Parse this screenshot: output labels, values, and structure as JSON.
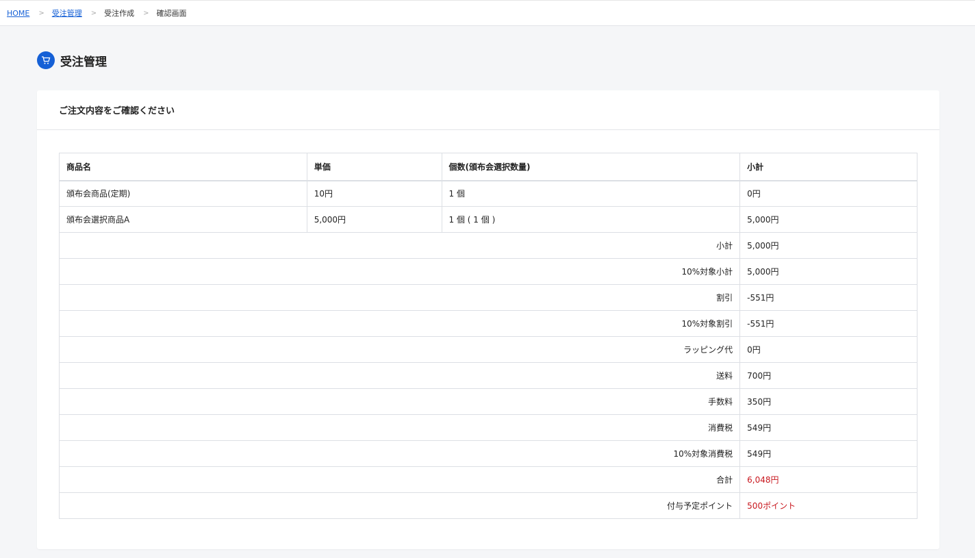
{
  "breadcrumb": {
    "home": "HOME",
    "order_mgmt": "受注管理",
    "order_create": "受注作成",
    "confirm": "確認画面",
    "separator": ">"
  },
  "page": {
    "title": "受注管理",
    "icon": "cart-icon"
  },
  "card": {
    "title": "ご注文内容をご確認ください"
  },
  "table": {
    "headers": {
      "name": "商品名",
      "price": "単価",
      "qty": "個数(頒布会選択数量)",
      "subtotal": "小計"
    },
    "items": [
      {
        "name": "頒布会商品(定期)",
        "price": "10円",
        "qty": "1 個",
        "subtotal": "0円"
      },
      {
        "name": "頒布会選択商品A",
        "price": "5,000円",
        "qty": "1 個 ( 1 個 )",
        "subtotal": "5,000円"
      }
    ],
    "summary": [
      {
        "label": "小計",
        "value": "5,000円"
      },
      {
        "label": "10%対象小計",
        "value": "5,000円"
      },
      {
        "label": "割引",
        "value": "-551円"
      },
      {
        "label": "10%対象割引",
        "value": "-551円"
      },
      {
        "label": "ラッピング代",
        "value": "0円"
      },
      {
        "label": "送料",
        "value": "700円"
      },
      {
        "label": "手数料",
        "value": "350円"
      },
      {
        "label": "消費税",
        "value": "549円"
      },
      {
        "label": "10%対象消費税",
        "value": "549円"
      },
      {
        "label": "合計",
        "value": "6,048円"
      },
      {
        "label": "付与予定ポイント",
        "value": "500ポイント"
      }
    ]
  },
  "colors": {
    "accent": "#1560d6",
    "highlight": "#c8171e"
  }
}
